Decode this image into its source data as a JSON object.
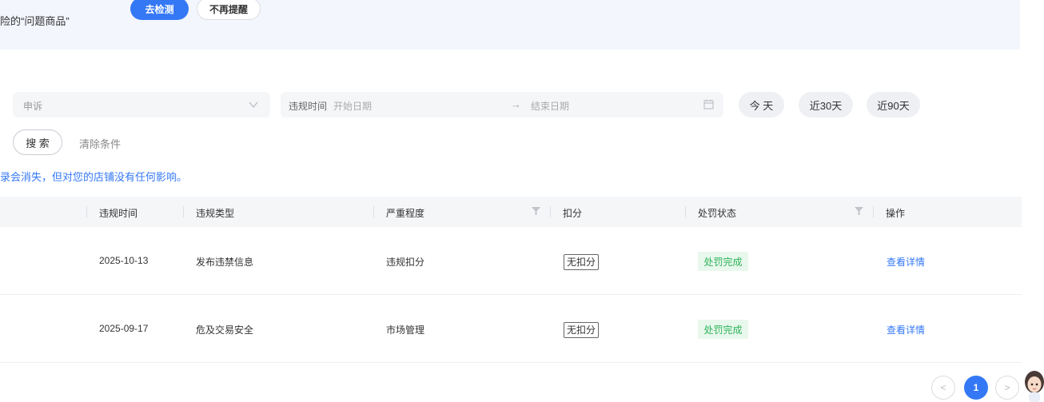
{
  "banner": {
    "text": "险的“问题商品”",
    "detect_button": "去检测",
    "dismiss_button": "不再提醒"
  },
  "filters": {
    "appeal_select_value": "申诉",
    "date_label": "违规时间",
    "start_placeholder": "开始日期",
    "separator": "→",
    "end_placeholder": "结束日期",
    "quick_ranges": [
      "今 天",
      "近30天",
      "近90天"
    ],
    "search_button": "搜 索",
    "clear_button": "清除条件"
  },
  "notice": "录会消失，但对您的店铺没有任何影响。",
  "table": {
    "columns": [
      "违规时间",
      "违规类型",
      "严重程度",
      "扣分",
      "处罚状态",
      "操作"
    ],
    "rows": [
      {
        "time": "2025-10-13",
        "type": "发布违禁信息",
        "severity": "违规扣分",
        "score": "无扣分",
        "status": "处罚完成",
        "action": "查看详情"
      },
      {
        "time": "2025-09-17",
        "type": "危及交易安全",
        "severity": "市场管理",
        "score": "无扣分",
        "status": "处罚完成",
        "action": "查看详情"
      }
    ]
  },
  "pagination": {
    "prev": "<",
    "current": "1",
    "next": ">"
  },
  "colors": {
    "accent": "#3478f6",
    "status_green": "#2fb35a",
    "status_green_bg": "#e8f8ec"
  }
}
